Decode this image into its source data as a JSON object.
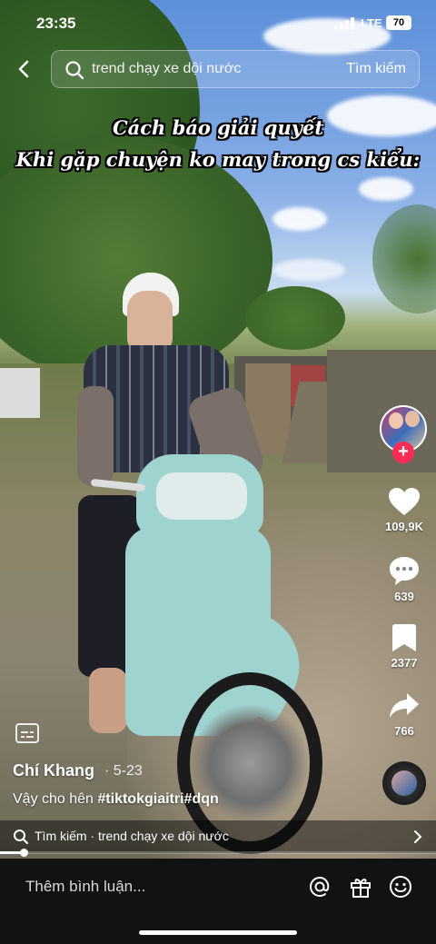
{
  "status_bar": {
    "time": "23:35",
    "network": "LTE",
    "battery": "70"
  },
  "search": {
    "query": "trend chạy xe dội nước",
    "button": "Tìm kiếm"
  },
  "overlay_text": {
    "line1": "Cách báo giải quyết",
    "line2": "Khi gặp chuyện ko may trong cs kiểu:"
  },
  "actions": {
    "likes": "109,9K",
    "comments": "639",
    "saves": "2377",
    "shares": "766"
  },
  "post": {
    "author": "Chí Khang",
    "date": "· 5-23",
    "caption_text": "Vậy cho hên ",
    "hashtag1": "#tiktokgiaitri",
    "hashtag2": "#dqn"
  },
  "search_strip": {
    "label": "Tìm kiếm · trend chạy xe dội nước"
  },
  "playback_progress_percent": 5.5,
  "comment_bar": {
    "placeholder": "Thêm bình luận..."
  },
  "icons": [
    "back-icon",
    "search-icon",
    "heart-icon",
    "comment-icon",
    "bookmark-icon",
    "share-icon",
    "captions-icon",
    "at-icon",
    "gift-icon",
    "emoji-icon",
    "chevron-right-icon"
  ],
  "colors": {
    "follow_accent": "#fe2c55",
    "bottom_bar": "#121212"
  }
}
